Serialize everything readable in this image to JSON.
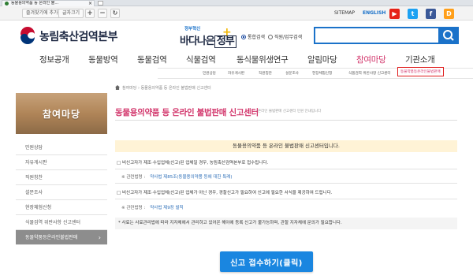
{
  "browser": {
    "tab_title": "동물용의약품 등 온라인 불...",
    "close_glyph": "×"
  },
  "utility_bar": {
    "favorites_label": "즐겨찾기에 추가",
    "font_size_label": "글자크기",
    "plus_label": "+",
    "minus_label": "−",
    "reset_label": "↻",
    "sitemap_label": "SITEMAP",
    "english_label": "ENGLISH",
    "social": [
      {
        "name": "youtube-icon",
        "glyph": "▶",
        "color": "#e62117"
      },
      {
        "name": "twitter-icon",
        "glyph": "t",
        "color": "#1da1f2"
      },
      {
        "name": "facebook-icon",
        "glyph": "f",
        "color": "#3b5998"
      },
      {
        "name": "blog-icon",
        "glyph": "D",
        "color": "#ff9f1a"
      }
    ]
  },
  "header": {
    "agency_name": "농림축산검역본부",
    "slogan_top": "정부혁신",
    "slogan_main_a": "바다나은",
    "slogan_main_b": "정부",
    "radio_all": "통합검색",
    "radio_staff": "직원/업무검색",
    "search_placeholder": ""
  },
  "gnb": [
    {
      "label": "정보공개",
      "active": false
    },
    {
      "label": "동물방역",
      "active": false
    },
    {
      "label": "동물검역",
      "active": false
    },
    {
      "label": "식물검역",
      "active": false
    },
    {
      "label": "동식물위생연구",
      "active": false
    },
    {
      "label": "알림마당",
      "active": false
    },
    {
      "label": "참여마당",
      "active": true
    },
    {
      "label": "기관소개",
      "active": false
    }
  ],
  "subnav": [
    "민원상담",
    "자유게시판",
    "직원칭찬",
    "설문조사",
    "현장체험신청",
    "식품검역 위반사항 신고센터",
    "동물약품등온라인불법판매"
  ],
  "breadcrumb": "참여마당 › 동물용의약품 등 온라인 불법판매 신고센터",
  "page": {
    "title": "동물용의약품 등 온라인 불법판매 신고센터",
    "desc": "온라인 불법판매 신고센터 민원 안내입니다"
  },
  "left_panel": {
    "banner_title": "참여마당",
    "items": [
      {
        "label": "민원상담",
        "active": false
      },
      {
        "label": "자유게시판",
        "active": false
      },
      {
        "label": "직원칭찬",
        "active": false
      },
      {
        "label": "설문조사",
        "active": false
      },
      {
        "label": "현장체험신청",
        "active": false
      },
      {
        "label": "식물검역 위반사항 신고센터",
        "active": false
      },
      {
        "label": "동물약품등온라인불법판매",
        "active": true
      }
    ],
    "arrow": "›"
  },
  "content": {
    "headline": "동물용의약품 등 온라인 불법판매 신고센터입니다.",
    "row1": "□ 비신고자가 제조·수입업체(신고)된 업체일 경우, 농림축산검역본부로 접수됩니다.",
    "row1_law_prefix": "※ 관련법령 :",
    "row1_law": "약사법 제85조(동물용의약품 등에 대한 특례)",
    "row2": "□ 비신고자가 제조·수입업체(신고)된 업체가 아닌 경우, 경찰신고가 필요하여 신고에 필요한 서식을 제공하여 드립니다.",
    "row2_law_prefix": "※ 관련법령 :",
    "row2_law": "약사법 제9장 벌칙",
    "note": "* 사료는 사료관리법에 따라 지자체에서 관리하고 있어온 해야에 등록 신고가 불가능하며, 관할 지자체에 문의가 필요합니다."
  },
  "report_button": "신고 접수하기(클릭)"
}
